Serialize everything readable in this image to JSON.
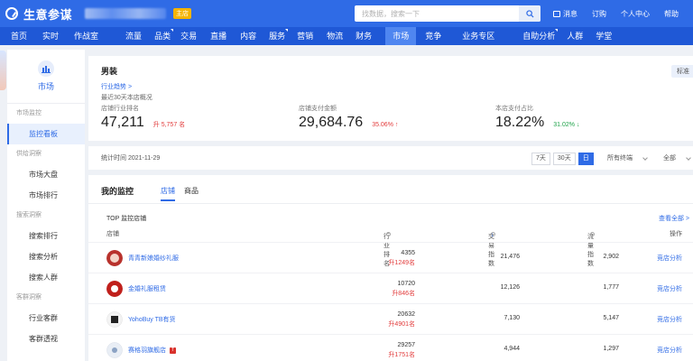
{
  "header": {
    "logo_text": "生意参谋",
    "badge": "主店",
    "search_placeholder": "找数据，搜索一下",
    "right_links": [
      "消息",
      "订购",
      "个人中心",
      "帮助"
    ]
  },
  "nav": {
    "items": [
      "首页",
      "实时",
      "作战室",
      "流量",
      "品类",
      "交易",
      "直播",
      "内容",
      "服务",
      "营销",
      "物流",
      "财务",
      "市场",
      "竞争",
      "业务专区",
      "自助分析",
      "人群",
      "学堂"
    ],
    "active": "市场"
  },
  "sidebar": {
    "title": "市场",
    "groups": [
      {
        "label": "市场监控",
        "items": [
          "监控看板"
        ]
      },
      {
        "label": "供给洞察",
        "items": [
          "市场大盘",
          "市场排行"
        ]
      },
      {
        "label": "搜索洞察",
        "items": [
          "搜索排行",
          "搜索分析",
          "搜索人群"
        ]
      },
      {
        "label": "客群洞察",
        "items": [
          "行业客群",
          "客群透视"
        ]
      }
    ],
    "active_item": "监控看板"
  },
  "summary": {
    "category": "男装",
    "tag_button": "标准",
    "trend_link": "行业趋势 >",
    "period_text": "最近30天本店概况",
    "metrics": [
      {
        "label": "店铺行业排名",
        "value": "47,211",
        "delta": "升 5,757 名",
        "direction": "up"
      },
      {
        "label": "店铺支付金额",
        "value": "29,684.76",
        "delta": "35.06% ↑",
        "direction": "up"
      },
      {
        "label": "本店支付占比",
        "value": "18.22%",
        "delta": "31.02% ↓",
        "direction": "down"
      }
    ]
  },
  "filter": {
    "stat_time": "统计时间 2021-11-29",
    "ranges": [
      "7天",
      "30天",
      "日"
    ],
    "active_range": "日",
    "terminal_select": "所有终端",
    "scope_select": "全部"
  },
  "monitor": {
    "title": "我的监控",
    "tabs": [
      "店铺",
      "商品"
    ],
    "active_tab": "店铺",
    "top_label": "TOP 监控店铺",
    "more_link": "查看全部 >",
    "columns": [
      "店铺",
      "行业排名",
      "交易指数",
      "流量指数",
      "操作"
    ],
    "rows": [
      {
        "shop": "青青新娘婚纱礼服",
        "rank": "4355",
        "rank_change": "升1249名",
        "trade": "21,476",
        "flow": "2,902",
        "action": "竞店分析",
        "tmall": false,
        "avatar_color": "#b8322c"
      },
      {
        "shop": "金婚礼服租赁",
        "rank": "10720",
        "rank_change": "升846名",
        "trade": "12,126",
        "flow": "1,777",
        "action": "竞店分析",
        "tmall": false,
        "avatar_color": "#c0201c"
      },
      {
        "shop": "YohoBuy TB有货",
        "rank": "20632",
        "rank_change": "升4901名",
        "trade": "7,130",
        "flow": "5,147",
        "action": "竞店分析",
        "tmall": false,
        "avatar_color": "#f3f3f3"
      },
      {
        "shop": "赛格羽旗舰店",
        "rank": "29257",
        "rank_change": "升1751名",
        "trade": "4,944",
        "flow": "1,297",
        "action": "竞店分析",
        "tmall": true,
        "avatar_color": "#e9eef5"
      }
    ]
  }
}
